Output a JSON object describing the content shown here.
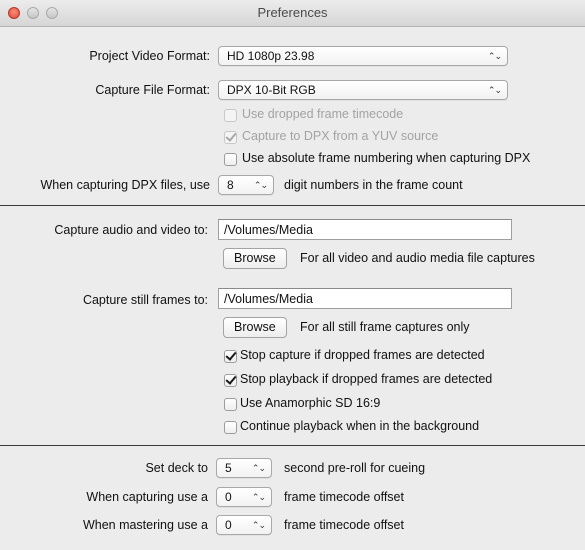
{
  "window": {
    "title": "Preferences"
  },
  "format": {
    "project_video_label": "Project Video Format:",
    "project_video_value": "HD 1080p 23.98",
    "capture_file_label": "Capture File Format:",
    "capture_file_value": "DPX 10-Bit RGB",
    "use_dropped_frame_label": "Use dropped frame timecode",
    "capture_dpx_yuv_label": "Capture to DPX from a YUV source",
    "absolute_frame_label": "Use absolute frame numbering when capturing DPX",
    "dpx_digits_label": "When capturing DPX files, use",
    "dpx_digits_value": "8",
    "dpx_digits_suffix": "digit numbers in the frame count"
  },
  "capture": {
    "av_label": "Capture audio and video to:",
    "av_path": "/Volumes/Media",
    "av_browse": "Browse",
    "av_note": "For all video and audio media file captures",
    "still_label": "Capture still frames to:",
    "still_path": "/Volumes/Media",
    "still_browse": "Browse",
    "still_note": "For all still frame captures only",
    "stop_capture_label": "Stop capture if dropped frames are detected",
    "stop_playback_label": "Stop playback if dropped frames are detected",
    "anamorphic_label": "Use Anamorphic SD 16:9",
    "continue_playback_label": "Continue playback when in the background"
  },
  "deck": {
    "preroll_label": "Set deck to",
    "preroll_value": "5",
    "preroll_suffix": "second pre-roll for cueing",
    "capture_offset_label": "When capturing use a",
    "capture_offset_value": "0",
    "capture_offset_suffix": "frame timecode offset",
    "master_offset_label": "When mastering use a",
    "master_offset_value": "0",
    "master_offset_suffix": "frame timecode offset"
  },
  "checkbox_states": {
    "use_dropped_frame": false,
    "capture_dpx_yuv": true,
    "absolute_frame": false,
    "stop_capture": true,
    "stop_playback": true,
    "anamorphic": false,
    "continue_playback": false
  }
}
